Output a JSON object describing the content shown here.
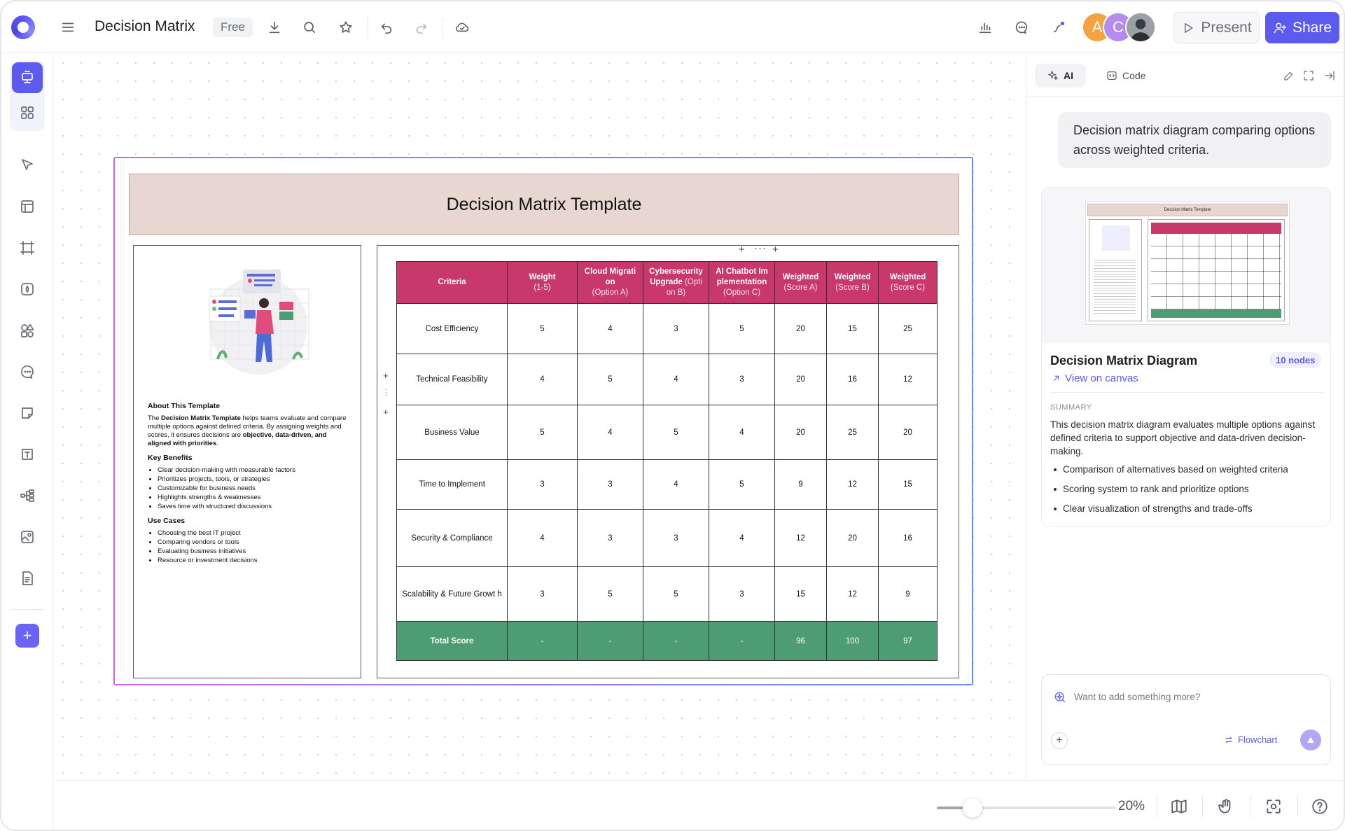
{
  "header": {
    "title": "Decision Matrix",
    "plan_badge": "Free",
    "present_label": "Present",
    "share_label": "Share",
    "avatars": [
      {
        "initial": "A",
        "color": "#f4a340"
      },
      {
        "initial": "C",
        "color": "#b48cf0"
      },
      {
        "initial": "",
        "color": "#6b6f78"
      }
    ]
  },
  "canvas": {
    "banner_title": "Decision Matrix Template",
    "about": {
      "heading": "About This Template",
      "intro_1": "The ",
      "intro_bold": "Decision Matrix Template",
      "intro_2": " helps teams evaluate and compare multiple options against defined criteria. By assigning weights and scores, it ensures decisions are ",
      "intro_bold_2": "objective, data-driven, and aligned with priorities",
      "intro_3": ".",
      "benefits_heading": "Key Benefits",
      "benefits": [
        "Clear decision-making with measurable factors",
        "Prioritizes projects, tools, or strategies",
        "Customizable for business needs",
        "Highlights strengths & weaknesses",
        "Saves time with structured discussions"
      ],
      "usecases_heading": "Use Cases",
      "usecases": [
        "Choosing the best IT project",
        "Comparing vendors or tools",
        "Evaluating business initiatives",
        "Resource or investment decisions"
      ]
    },
    "table": {
      "headers": [
        {
          "main": "Criteria",
          "sub": ""
        },
        {
          "main": "Weight",
          "sub": "(1-5)"
        },
        {
          "main": "Cloud Migrati on",
          "sub": "(Option A)"
        },
        {
          "main": "Cybersecurity Upgrade",
          "sub": "(Opti on B)"
        },
        {
          "main": "AI Chatbot Im plementation",
          "sub": "(Option C)"
        },
        {
          "main": "Weighted",
          "sub": "(Score A)"
        },
        {
          "main": "Weighted",
          "sub": "(Score B)"
        },
        {
          "main": "Weighted",
          "sub": "(Score C)"
        }
      ],
      "rows": [
        [
          "Cost Efficiency",
          "5",
          "4",
          "3",
          "5",
          "20",
          "15",
          "25"
        ],
        [
          "Technical Feasibility",
          "4",
          "5",
          "4",
          "3",
          "20",
          "16",
          "12"
        ],
        [
          "Business Value",
          "5",
          "4",
          "5",
          "4",
          "20",
          "25",
          "20"
        ],
        [
          "Time to Implement",
          "3",
          "3",
          "4",
          "5",
          "9",
          "12",
          "15"
        ],
        [
          "Security & Compliance",
          "4",
          "3",
          "3",
          "4",
          "12",
          "20",
          "16"
        ],
        [
          "Scalability & Future Growt h",
          "3",
          "5",
          "5",
          "3",
          "15",
          "12",
          "9"
        ]
      ],
      "total": [
        "Total Score",
        "-",
        "-",
        "-",
        "-",
        "96",
        "100",
        "97"
      ]
    }
  },
  "panel": {
    "tabs": [
      "AI",
      "Code"
    ],
    "prompt": "Decision matrix diagram comparing options across weighted criteria.",
    "result": {
      "thumb_title": "Decision Matrix Template",
      "title": "Decision Matrix Diagram",
      "nodes_badge": "10 nodes",
      "view_link": "View on canvas",
      "summary_label": "SUMMARY",
      "summary": "This decision matrix diagram evaluates multiple options against defined criteria to support objective and data-driven decision-making.",
      "bullets": [
        "Comparison of alternatives based on weighted criteria",
        "Scoring system to rank and prioritize options",
        "Clear visualization of strengths and trade-offs"
      ]
    },
    "chat": {
      "placeholder": "Want to add something more?",
      "mode": "Flowchart"
    }
  },
  "footer": {
    "zoom_text": "20%",
    "zoom_level": 0.2
  },
  "colors": {
    "accent": "#5b5bf0",
    "table_header": "#c8386b",
    "total_row": "#4e9c73",
    "banner": "#e8d6d0"
  }
}
